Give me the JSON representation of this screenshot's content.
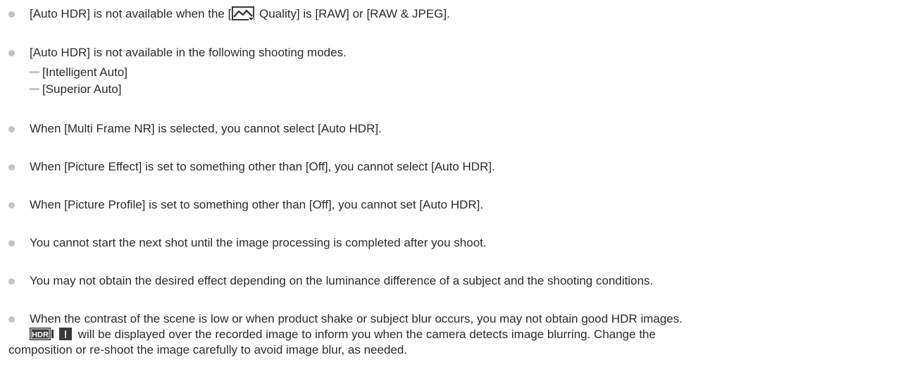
{
  "notes": {
    "n1": {
      "before": "[Auto HDR] is not available when the [",
      "after": " Quality] is [RAW] or [RAW & JPEG]."
    },
    "n2": {
      "text": "[Auto HDR] is not available in the following shooting modes.",
      "sub_items": [
        "[Intelligent Auto]",
        "[Superior Auto]"
      ]
    },
    "n3": "When [Multi Frame NR] is selected, you cannot select [Auto HDR].",
    "n4": "When [Picture Effect] is set to something other than [Off], you cannot select [Auto HDR].",
    "n5": "When [Picture Profile] is set to something other than [Off], you cannot set [Auto HDR].",
    "n6": "You cannot start the next shot until the image processing is completed after you shoot.",
    "n7": "You may not obtain the desired effect depending on the luminance difference of a subject and the shooting conditions.",
    "n8": {
      "line1": "When the contrast of the scene is low or when product shake or subject blur occurs, you may not obtain good HDR images.",
      "icon_hdr": "HDR",
      "icon_alert": "!",
      "line2_after_icon": " will be displayed over the recorded image to inform you when the camera detects image blurring. Change the",
      "line3": "composition or re-shoot the image carefully to avoid image blur, as needed."
    }
  },
  "icons": {
    "bullet": "grey-dot-icon",
    "sub_bullet": "dash-icon",
    "quality": "image-quality-icon",
    "hdr_warning": "hdr-warning-icon"
  },
  "colors": {
    "text": "#2b2b2b",
    "bullet": "#c4c4c4",
    "icon_dark": "#3a3a3a"
  }
}
